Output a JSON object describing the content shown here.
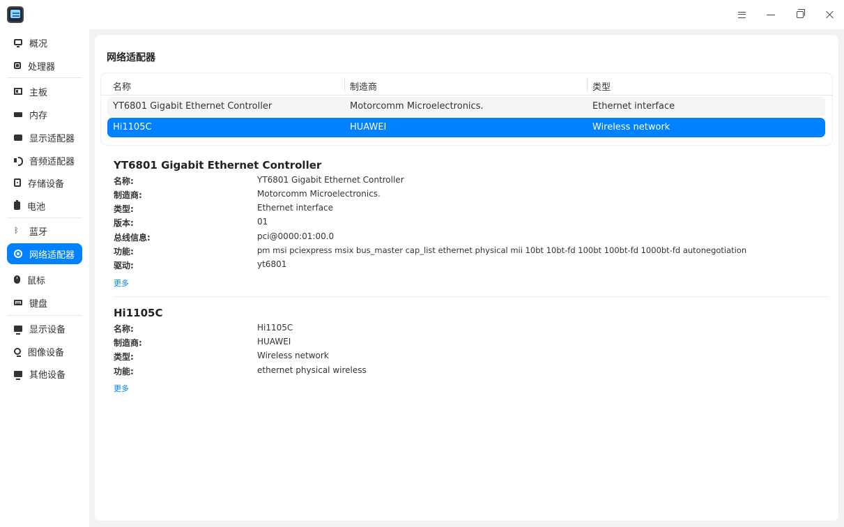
{
  "window": {
    "app_icon": "device-manager-icon",
    "buttons": [
      "menu-icon",
      "minimize-icon",
      "maximize-icon",
      "close-icon"
    ]
  },
  "sidebar": {
    "items": [
      {
        "label": "概况",
        "icon": "overview-icon"
      },
      {
        "label": "处理器",
        "icon": "cpu-icon"
      },
      {
        "label": "主板",
        "icon": "motherboard-icon"
      },
      {
        "label": "内存",
        "icon": "memory-icon"
      },
      {
        "label": "显示适配器",
        "icon": "display-adapter-icon"
      },
      {
        "label": "音频适配器",
        "icon": "audio-icon"
      },
      {
        "label": "存储设备",
        "icon": "storage-icon"
      },
      {
        "label": "电池",
        "icon": "battery-icon"
      },
      {
        "label": "蓝牙",
        "icon": "bluetooth-icon"
      },
      {
        "label": "网络适配器",
        "icon": "network-icon",
        "active": true
      },
      {
        "label": "鼠标",
        "icon": "mouse-icon"
      },
      {
        "label": "键盘",
        "icon": "keyboard-icon"
      },
      {
        "label": "显示设备",
        "icon": "monitor-icon"
      },
      {
        "label": "图像设备",
        "icon": "camera-icon"
      },
      {
        "label": "其他设备",
        "icon": "other-device-icon"
      }
    ]
  },
  "main": {
    "title": "网络适配器",
    "table": {
      "headers": [
        "名称",
        "制造商",
        "类型"
      ],
      "rows": [
        [
          "YT6801 Gigabit Ethernet Controller",
          "Motorcomm Microelectronics.",
          "Ethernet interface"
        ],
        [
          "Hi1105C",
          "HUAWEI",
          "Wireless network"
        ]
      ],
      "selected_row": 1
    },
    "devices": [
      {
        "title": "YT6801 Gigabit Ethernet Controller",
        "fields": [
          {
            "key": "名称:",
            "value": "YT6801 Gigabit Ethernet Controller"
          },
          {
            "key": "制造商:",
            "value": "Motorcomm Microelectronics."
          },
          {
            "key": "类型:",
            "value": "Ethernet interface"
          },
          {
            "key": "版本:",
            "value": "01"
          },
          {
            "key": "总线信息:",
            "value": "pci@0000:01:00.0"
          },
          {
            "key": "功能:",
            "value": "pm msi pciexpress msix bus_master cap_list ethernet physical mii 10bt 10bt-fd 100bt 100bt-fd 1000bt-fd autonegotiation"
          },
          {
            "key": "驱动:",
            "value": "yt6801"
          }
        ],
        "more": "更多"
      },
      {
        "title": "Hi1105C",
        "fields": [
          {
            "key": "名称:",
            "value": "Hi1105C"
          },
          {
            "key": "制造商:",
            "value": "HUAWEI"
          },
          {
            "key": "类型:",
            "value": "Wireless network"
          },
          {
            "key": "功能:",
            "value": "ethernet physical wireless"
          }
        ],
        "more": "更多"
      }
    ]
  },
  "colors": {
    "accent": "#0081ff",
    "background": "#f2f2f2",
    "panel": "#ffffff"
  }
}
